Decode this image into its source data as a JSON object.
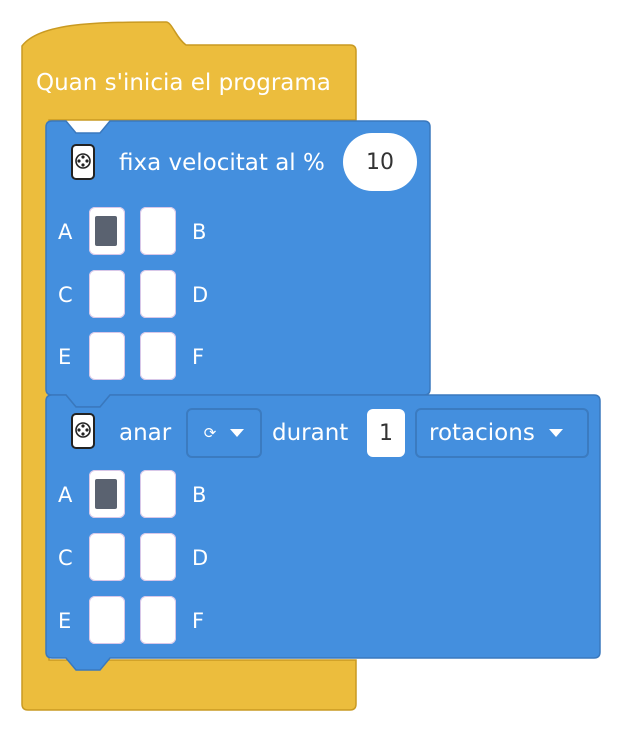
{
  "hat_block": {
    "label": "Quan s'inicia el programa",
    "color": "#ecbd3d",
    "border_color": "#c99a22"
  },
  "speed_block": {
    "label": "fixa velocitat al %",
    "value": "10",
    "icon": "motor-hub-icon",
    "color": "#448fde",
    "border_color": "#3a78bd",
    "ports": [
      {
        "letter": "A",
        "selected": true
      },
      {
        "letter": "B",
        "selected": false
      },
      {
        "letter": "C",
        "selected": false
      },
      {
        "letter": "D",
        "selected": false
      },
      {
        "letter": "E",
        "selected": false
      },
      {
        "letter": "F",
        "selected": false
      }
    ]
  },
  "move_block": {
    "label_go": "anar",
    "direction_icon": "clockwise-icon",
    "direction_glyph": "⟳",
    "label_for": "durant",
    "amount": "1",
    "unit": "rotacions",
    "icon": "motor-hub-icon",
    "ports": [
      {
        "letter": "A",
        "selected": true
      },
      {
        "letter": "B",
        "selected": false
      },
      {
        "letter": "C",
        "selected": false
      },
      {
        "letter": "D",
        "selected": false
      },
      {
        "letter": "E",
        "selected": false
      },
      {
        "letter": "F",
        "selected": false
      }
    ]
  }
}
